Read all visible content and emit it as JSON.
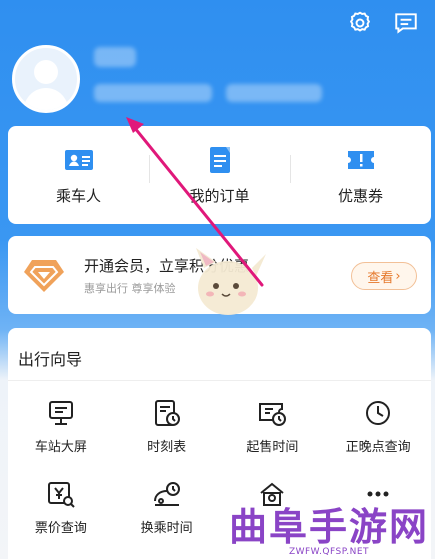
{
  "header": {
    "settings_icon": "gear-icon",
    "message_icon": "chat-message-icon"
  },
  "quick_actions": [
    {
      "label": "乘车人",
      "icon": "passenger-card-icon"
    },
    {
      "label": "我的订单",
      "icon": "order-list-icon"
    },
    {
      "label": "优惠券",
      "icon": "coupon-icon"
    }
  ],
  "vip": {
    "title": "开通会员，立享积分优惠",
    "subtitle": "惠享出行 尊享体验",
    "button_label": "查看",
    "button_arrow": "›"
  },
  "guide": {
    "title": "出行向导",
    "items": [
      {
        "label": "车站大屏",
        "icon": "screen-icon"
      },
      {
        "label": "时刻表",
        "icon": "timetable-icon"
      },
      {
        "label": "起售时间",
        "icon": "sale-time-icon"
      },
      {
        "label": "正晚点查询",
        "icon": "clock-icon"
      },
      {
        "label": "票价查询",
        "icon": "fare-search-icon"
      },
      {
        "label": "换乘时间",
        "icon": "transfer-time-icon"
      },
      {
        "label": "",
        "icon": "station-icon"
      },
      {
        "label": "",
        "icon": "more-icon"
      }
    ]
  },
  "watermark": {
    "text": "曲阜手游网",
    "url": "ZWFW.QFSP.NET"
  },
  "colors": {
    "brand_blue": "#3a97f2",
    "accent_orange": "#e5782b",
    "annotation": "#e0187a",
    "watermark": "#8a44c6"
  }
}
